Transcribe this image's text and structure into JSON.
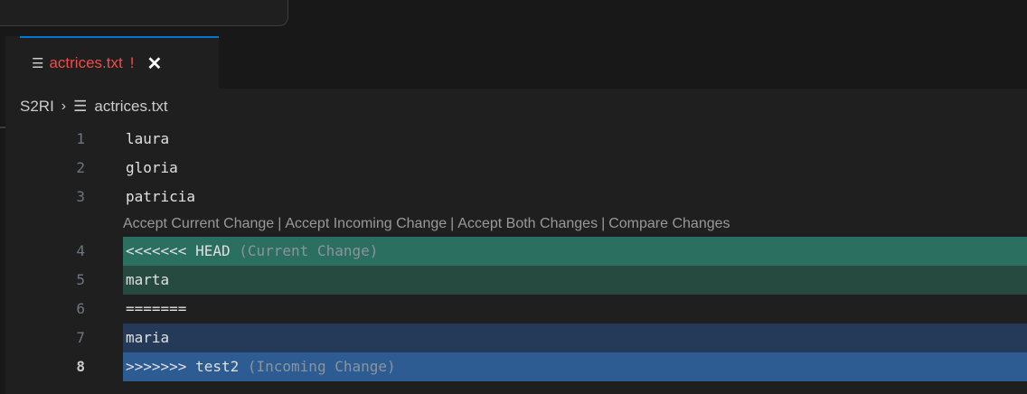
{
  "tab": {
    "icon": "file-lines-icon",
    "label": "actrices.txt",
    "warning": "!",
    "close": "✕"
  },
  "breadcrumb": {
    "folder": "S2RI",
    "separator": "›",
    "file": "actrices.txt"
  },
  "codelens": {
    "accept_current": "Accept Current Change",
    "accept_incoming": "Accept Incoming Change",
    "accept_both": "Accept Both Changes",
    "compare": "Compare Changes",
    "separator": "|"
  },
  "lines": [
    {
      "num": "1",
      "text": "laura"
    },
    {
      "num": "2",
      "text": "gloria"
    },
    {
      "num": "3",
      "text": "patricia"
    },
    {
      "num": "4",
      "text": "<<<<<<< HEAD",
      "tag": "(Current Change)"
    },
    {
      "num": "5",
      "text": "marta"
    },
    {
      "num": "6",
      "text": "======="
    },
    {
      "num": "7",
      "text": "maria"
    },
    {
      "num": "8",
      "text": ">>>>>>> test2",
      "tag": "(Incoming Change)"
    }
  ],
  "colors": {
    "current_header": "#2b6f60",
    "current_body": "#264a40",
    "incoming_body": "#243a58",
    "incoming_header": "#2c5c91",
    "tab_accent": "#0078d4",
    "conflict_text": "#f14c4c"
  }
}
